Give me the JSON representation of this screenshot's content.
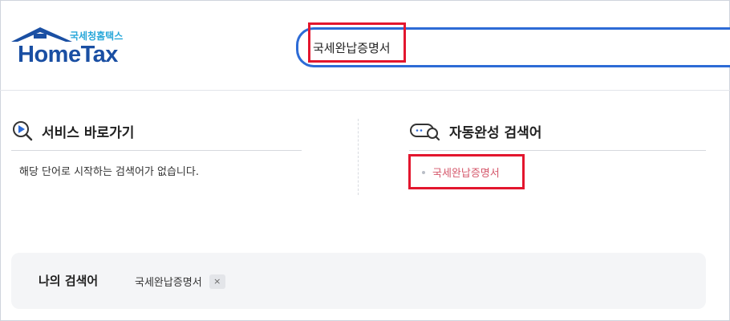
{
  "header": {
    "logo": {
      "korean_name": "국세청홈택스",
      "english_name": "HomeTax"
    },
    "search": {
      "value": "국세완납증명서"
    }
  },
  "service_shortcut": {
    "title": "서비스 바로가기",
    "empty_message": "해당 단어로 시작하는 검색어가 없습니다."
  },
  "autocomplete": {
    "title": "자동완성 검색어",
    "items": [
      {
        "label": "국세완납증명서"
      }
    ]
  },
  "my_searches": {
    "title": "나의 검색어",
    "items": [
      {
        "label": "국세완납증명서",
        "remove_symbol": "×"
      }
    ]
  },
  "colors": {
    "brand_blue": "#1a4fa3",
    "brand_light_blue": "#27a7d9",
    "search_border": "#2d6bd6",
    "autocomplete_text": "#d5586b",
    "highlight_red": "#e3162e"
  },
  "icons": {
    "service_shortcut": "play-search-icon",
    "autocomplete": "chat-search-icon",
    "remove": "close-icon"
  }
}
